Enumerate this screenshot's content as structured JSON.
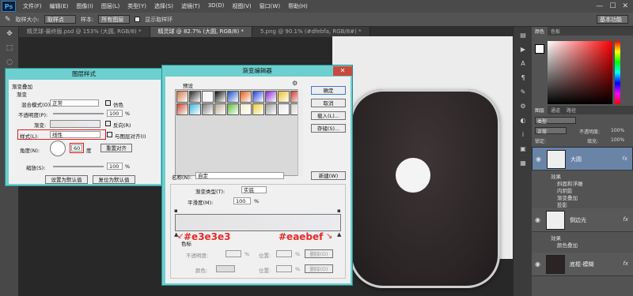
{
  "app": {
    "logo": "Ps"
  },
  "menu": [
    "文件(F)",
    "编辑(E)",
    "图像(I)",
    "图层(L)",
    "类型(Y)",
    "选择(S)",
    "滤镜(T)",
    "3D(D)",
    "视图(V)",
    "窗口(W)",
    "帮助(H)"
  ],
  "window_controls": {
    "minimize": "—",
    "maximize": "☐",
    "close": "✕"
  },
  "options": {
    "sample_size_label": "取样大小:",
    "sample_size_value": "取样点",
    "sample_label": "样本:",
    "sample_value": "所有图层",
    "show_ring_label": "显示取样环",
    "workspace": "基本功能"
  },
  "tabs": [
    "精灵球-最终版.psd @ 153% (大圆, RGB/8) *",
    "精灵球 @ 82.7% (大圆, RGB/8) *",
    "5.png @ 90.1% (#dfebfa, RGB/8#) *"
  ],
  "right_panels": {
    "color_tab": "颜色",
    "swatches_tab": "色板",
    "layers_tab": "图层",
    "channels_tab": "通道",
    "paths_tab": "路径",
    "kind_label": "类型",
    "blend": "正常",
    "opacity_label": "不透明度:",
    "opacity_value": "100%",
    "lock_label": "锁定:",
    "fill_label": "填充:",
    "fill_value": "100%"
  },
  "layers": [
    {
      "name": "大圆",
      "fx": "fx",
      "effects_label": "效果",
      "effects": [
        "斜面和浮雕",
        "内阴影",
        "渐变叠加",
        "投影"
      ]
    },
    {
      "name": "倒边光",
      "fx": "fx",
      "effects_label": "效果",
      "effects": [
        "颜色叠加"
      ]
    },
    {
      "name": "底框-模糊",
      "fx": "fx"
    }
  ],
  "layer_style": {
    "title": "图层样式",
    "section": "渐变叠加",
    "subsection": "渐变",
    "blend_mode_label": "混合模式(O):",
    "blend_mode_value": "正常",
    "dither_label": "仿色",
    "opacity_label": "不透明度(P):",
    "opacity_value": "100",
    "gradient_label": "渐变:",
    "reverse_label": "反向(R)",
    "style_label": "样式(L):",
    "style_value": "线性",
    "align_label": "与图层对齐(I)",
    "angle_label": "角度(N):",
    "angle_value": "60",
    "angle_unit": "度",
    "reset_align_label": "重置对齐",
    "scale_label": "缩放(S):",
    "scale_value": "100",
    "percent": "%",
    "set_default_label": "设置为默认值",
    "reset_default_label": "复位为默认值"
  },
  "gradient_editor": {
    "title": "渐变编辑器",
    "presets_label": "预设",
    "ok_label": "确定",
    "cancel_label": "取消",
    "load_label": "载入(L)...",
    "save_label": "存储(S)...",
    "name_label": "名称(N):",
    "name_value": "自定",
    "new_label": "新建(W)",
    "type_label": "渐变类型(T):",
    "type_value": "实底",
    "smooth_label": "平滑度(M):",
    "smooth_value": "100",
    "percent": "%",
    "stops_label": "色标",
    "opacity_label": "不透明度:",
    "position_label": "位置:",
    "delete_label": "删除(D)",
    "color_label": "颜色:",
    "close_label": "✕",
    "left_color": "#e3e3e3",
    "right_color": "#eaebef",
    "presets": [
      "#d4784a",
      "#2b2b2b",
      "#f0f0f0",
      "#0b0b0b",
      "#1f4fc6",
      "#e35d1b",
      "#2244dd",
      "#8c2ad1",
      "#e9c12a",
      "#d63f2a",
      "#c94b2f",
      "#3db8e0",
      "#7d7d7d",
      "#b9a58a",
      "#5cbf3a",
      "#f2eccd",
      "#ebcf3c",
      "#9c9c9c",
      "#e7e7e7",
      "#d3d3d3"
    ]
  },
  "annotations": {
    "left": "#e3e3e3",
    "right": "#eaebef"
  }
}
